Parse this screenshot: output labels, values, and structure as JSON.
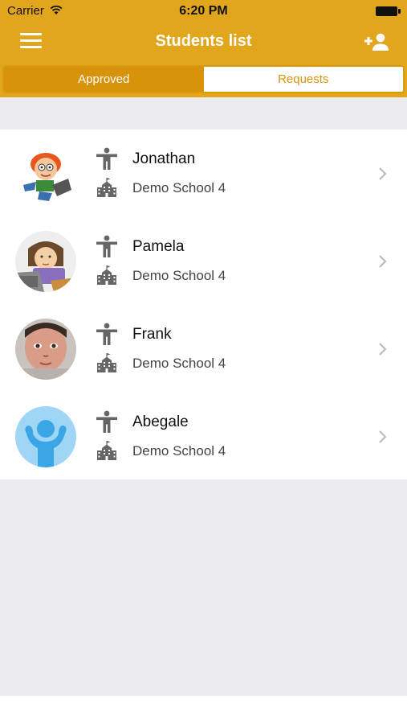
{
  "status_bar": {
    "carrier": "Carrier",
    "time": "6:20 PM"
  },
  "header": {
    "title": "Students list",
    "menu_icon": "hamburger-menu-icon",
    "action_icon": "add-user-icon"
  },
  "tabs": [
    {
      "label": "Approved",
      "selected": true
    },
    {
      "label": "Requests",
      "selected": false
    }
  ],
  "students": [
    {
      "name": "Jonathan",
      "school": "Demo School 4"
    },
    {
      "name": "Pamela",
      "school": "Demo School 4"
    },
    {
      "name": "Frank",
      "school": "Demo School 4"
    },
    {
      "name": "Abegale",
      "school": "Demo School 4"
    }
  ],
  "colors": {
    "accent": "#e2a61c",
    "segment_active": "#d8930a",
    "background": "#ebebf0"
  }
}
